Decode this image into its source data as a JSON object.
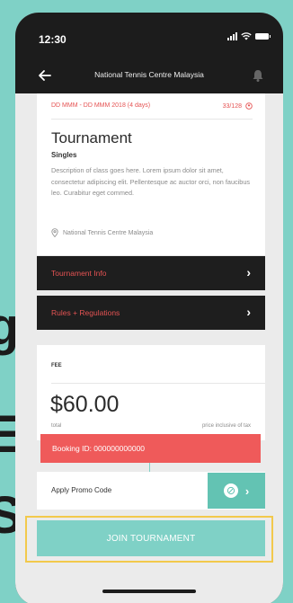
{
  "status_bar": {
    "time": "12:30"
  },
  "nav": {
    "title": "National Tennis Centre Malaysia"
  },
  "event": {
    "dates": "DD MMM - DD MMM 2018 (4 days)",
    "capacity": "33/128",
    "title": "Tournament",
    "category": "Singles",
    "description": "Description of class goes here. Lorem ipsum dolor sit amet, consectetur adipiscing elit. Pellentesque ac auctor orci, non faucibus leo. Curabitur eget commed.",
    "venue": "National Tennis Centre Malaysia"
  },
  "sections": [
    {
      "label": "Tournament Info"
    },
    {
      "label": "Rules + Regulations"
    }
  ],
  "fee": {
    "label": "FEE",
    "price": "$60.00",
    "total_label": "total",
    "tax_note": "price inclusive of tax"
  },
  "booking": {
    "id_text": "Booking ID: 000000000000"
  },
  "promo": {
    "label": "Apply Promo Code"
  },
  "join": {
    "label": "JOIN TOURNAMENT"
  },
  "colors": {
    "accent_teal": "#7fd1c6",
    "accent_red": "#e55353",
    "booking_red": "#ef5a5a",
    "dark": "#1c1c1c",
    "highlight": "#f2c94c"
  },
  "icons": [
    "back-arrow-icon",
    "bell-icon",
    "location-pin-icon",
    "chevron-right-icon",
    "coupon-icon",
    "user-icon"
  ]
}
